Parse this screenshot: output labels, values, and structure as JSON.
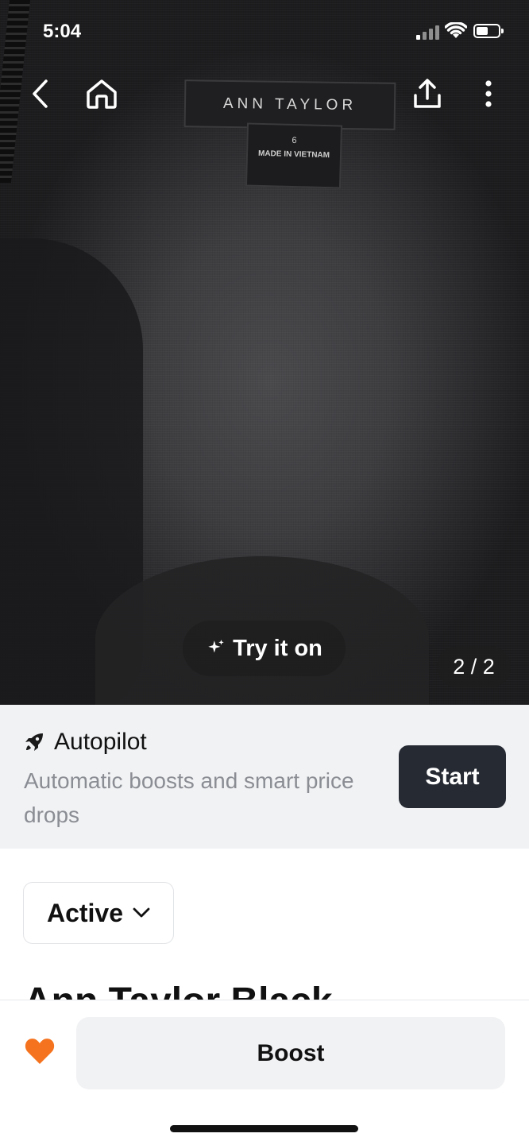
{
  "status_bar": {
    "time": "5:04"
  },
  "photo": {
    "brand_label_text": "ANN TAYLOR",
    "size_label_size": "6",
    "size_label_origin": "MADE IN VIETNAM",
    "try_on_label": "Try it on",
    "counter": "2 / 2"
  },
  "nav": {
    "back_icon": "chevron-left-icon",
    "home_icon": "home-icon",
    "share_icon": "share-icon",
    "more_icon": "more-vertical-icon"
  },
  "autopilot": {
    "icon": "rocket-icon",
    "title": "Autopilot",
    "description": "Automatic boosts and smart price drops",
    "start_label": "Start"
  },
  "listing": {
    "status": "Active",
    "title": "Ann Taylor Black"
  },
  "bottom_bar": {
    "heart_icon": "heart-icon",
    "heart_color": "#f5731e",
    "boost_label": "Boost"
  }
}
